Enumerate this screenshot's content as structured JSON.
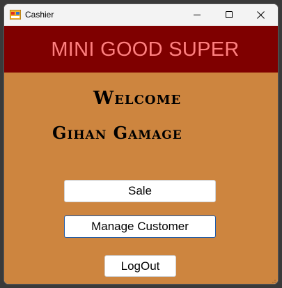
{
  "window": {
    "title": "Cashier"
  },
  "banner": {
    "text": "MINI GOOD SUPER"
  },
  "main": {
    "welcome": "Welcome",
    "user_name": "Gihan Gamage"
  },
  "buttons": {
    "sale": "Sale",
    "manage_customer": "Manage Customer",
    "logout": "LogOut"
  },
  "colors": {
    "banner_bg": "#7f0000",
    "banner_text": "#ff8080",
    "client_bg": "#cd853f"
  },
  "icons": {
    "app": "windows-form-icon",
    "minimize": "minimize-icon",
    "maximize": "maximize-icon",
    "close": "close-icon",
    "grip": "resize-grip-icon"
  }
}
